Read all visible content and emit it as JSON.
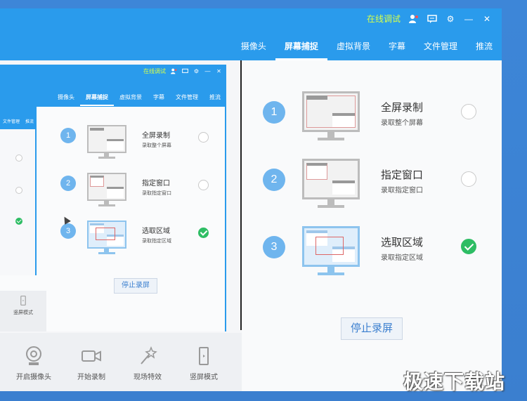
{
  "outer": {
    "titlebar": {
      "online_label": "在线调试",
      "icons": [
        "user-icon",
        "chat-icon",
        "gear-icon",
        "minimize-icon",
        "close-icon"
      ]
    },
    "nav": [
      "摄像头",
      "屏幕捕捉",
      "虚拟背景",
      "字幕",
      "文件管理",
      "推流"
    ],
    "active_tab": "屏幕捕捉",
    "options": [
      {
        "num": "1",
        "title": "全屏录制",
        "sub": "录取整个屏幕",
        "checked": false
      },
      {
        "num": "2",
        "title": "指定窗口",
        "sub": "录取指定窗口",
        "checked": false
      },
      {
        "num": "3",
        "title": "选取区域",
        "sub": "录取指定区域",
        "checked": true
      }
    ],
    "stop_button": "停止录屏",
    "bottom": [
      {
        "label": "开启摄像头",
        "icon": "webcam-icon"
      },
      {
        "label": "开始录制",
        "icon": "video-camera-icon"
      },
      {
        "label": "现场特效",
        "icon": "magic-wand-icon"
      },
      {
        "label": "竖屏模式",
        "icon": "portrait-phone-icon"
      }
    ]
  },
  "middle": {
    "titlebar": {
      "online_label": "在线调试"
    },
    "nav": [
      "摄像头",
      "屏幕捕捉",
      "虚拟背景",
      "字幕",
      "文件管理",
      "推流"
    ],
    "options": [
      {
        "num": "1",
        "title": "全屏录制",
        "sub": "录取整个屏幕",
        "checked": false
      },
      {
        "num": "2",
        "title": "指定窗口",
        "sub": "录取指定窗口",
        "checked": false
      },
      {
        "num": "3",
        "title": "选取区域",
        "sub": "录取指定区域",
        "checked": true
      }
    ],
    "stop_button": "停止录屏",
    "bottom_left": {
      "label": "竖屏模式"
    }
  },
  "inner": {
    "nav": [
      "文件管理",
      "推流"
    ]
  },
  "watermark": "极速下载站",
  "colors": {
    "accent": "#2a9bec",
    "check": "#2ebd64",
    "online": "#d6ff4a",
    "badge": "#6fb5ee"
  }
}
